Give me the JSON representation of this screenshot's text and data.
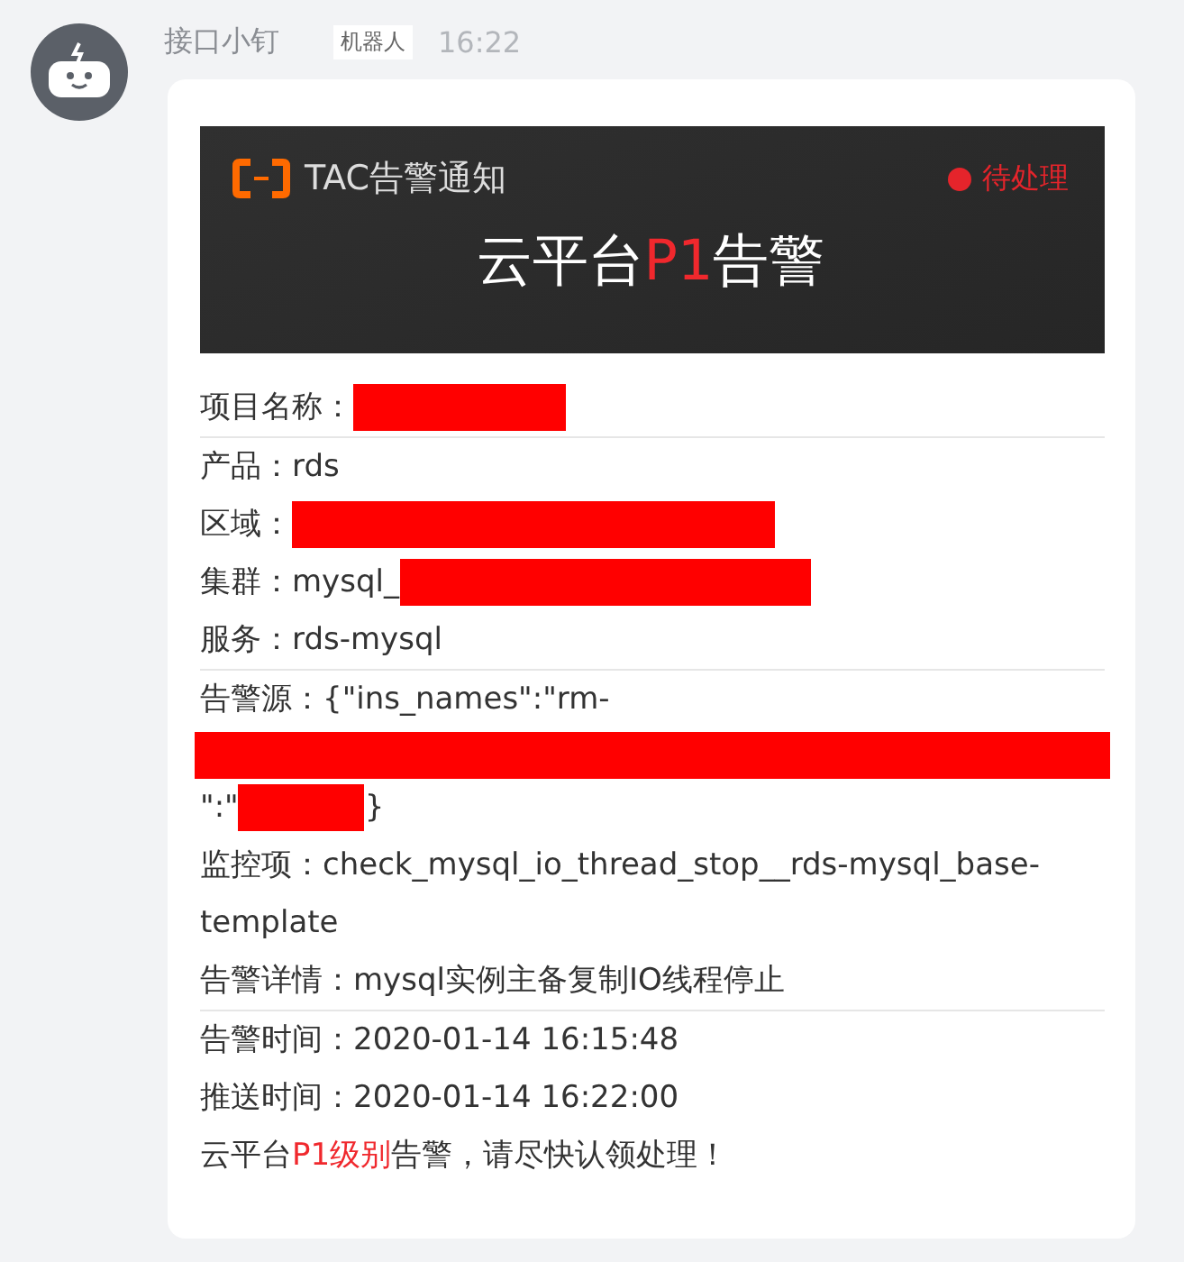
{
  "sender": {
    "name": "接口小钉",
    "badge": "机器人",
    "time": "16:22"
  },
  "banner": {
    "brand": "TAC告警通知",
    "status": "待处理",
    "title": [
      {
        "text": "云平台",
        "highlight": false
      },
      {
        "text": "P1",
        "highlight": true
      },
      {
        "text": "告警",
        "highlight": false
      }
    ]
  },
  "fields": [
    {
      "label": "项目名称：",
      "segments": [
        {
          "kind": "redaction"
        }
      ],
      "divider_after": true
    },
    {
      "label": "产品：",
      "segments": [
        {
          "kind": "text",
          "text": "rds"
        }
      ],
      "divider_after": false
    },
    {
      "label": "区域：",
      "segments": [
        {
          "kind": "redaction"
        }
      ],
      "divider_after": false
    },
    {
      "label": "集群：",
      "segments": [
        {
          "kind": "text",
          "text": "mysql_"
        },
        {
          "kind": "redaction"
        }
      ],
      "divider_after": false
    },
    {
      "label": "服务：",
      "segments": [
        {
          "kind": "text",
          "text": "rds-mysql"
        }
      ],
      "divider_after": true
    },
    {
      "label": "告警源：",
      "segments": [
        {
          "kind": "text",
          "text": "{\"ins_names\":\"rm-"
        },
        {
          "kind": "redaction"
        },
        {
          "kind": "text",
          "text": "\":\""
        },
        {
          "kind": "redaction"
        },
        {
          "kind": "text",
          "text": "}"
        }
      ],
      "divider_after": false
    },
    {
      "label": "监控项：",
      "segments": [
        {
          "kind": "text",
          "text": "check_mysql_io_thread_stop__rds-mysql_base-template"
        }
      ],
      "divider_after": false
    },
    {
      "label": "告警详情：",
      "segments": [
        {
          "kind": "text",
          "text": "mysql实例主备复制IO线程停止"
        }
      ],
      "divider_after": true
    },
    {
      "label": "告警时间：",
      "segments": [
        {
          "kind": "text",
          "text": "2020-01-14 16:15:48"
        }
      ],
      "divider_after": false
    },
    {
      "label": "推送时间：",
      "segments": [
        {
          "kind": "text",
          "text": "2020-01-14 16:22:00"
        }
      ],
      "divider_after": false
    }
  ],
  "footer": [
    {
      "text": "云平台",
      "highlight": false
    },
    {
      "text": "P1级别",
      "highlight": true
    },
    {
      "text": "告警，请尽快认领处理！",
      "highlight": false
    }
  ]
}
